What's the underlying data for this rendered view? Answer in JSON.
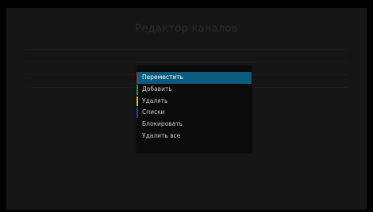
{
  "screen": {
    "title": "Редактор каналов"
  },
  "popup_menu": {
    "items": [
      {
        "label": "Переместить",
        "marker_color": "#d1161c",
        "selected": true
      },
      {
        "label": "Добавить",
        "marker_color": "#1f9b2c",
        "selected": false
      },
      {
        "label": "Удалять",
        "marker_color": "#e0b918",
        "selected": false
      },
      {
        "label": "Списки",
        "marker_color": "#1a3fbf",
        "selected": false
      },
      {
        "label": "Блокировать",
        "marker_color": "",
        "selected": false
      },
      {
        "label": "Удалить все",
        "marker_color": "",
        "selected": false
      }
    ],
    "selected_color": "#0c5b7c"
  }
}
